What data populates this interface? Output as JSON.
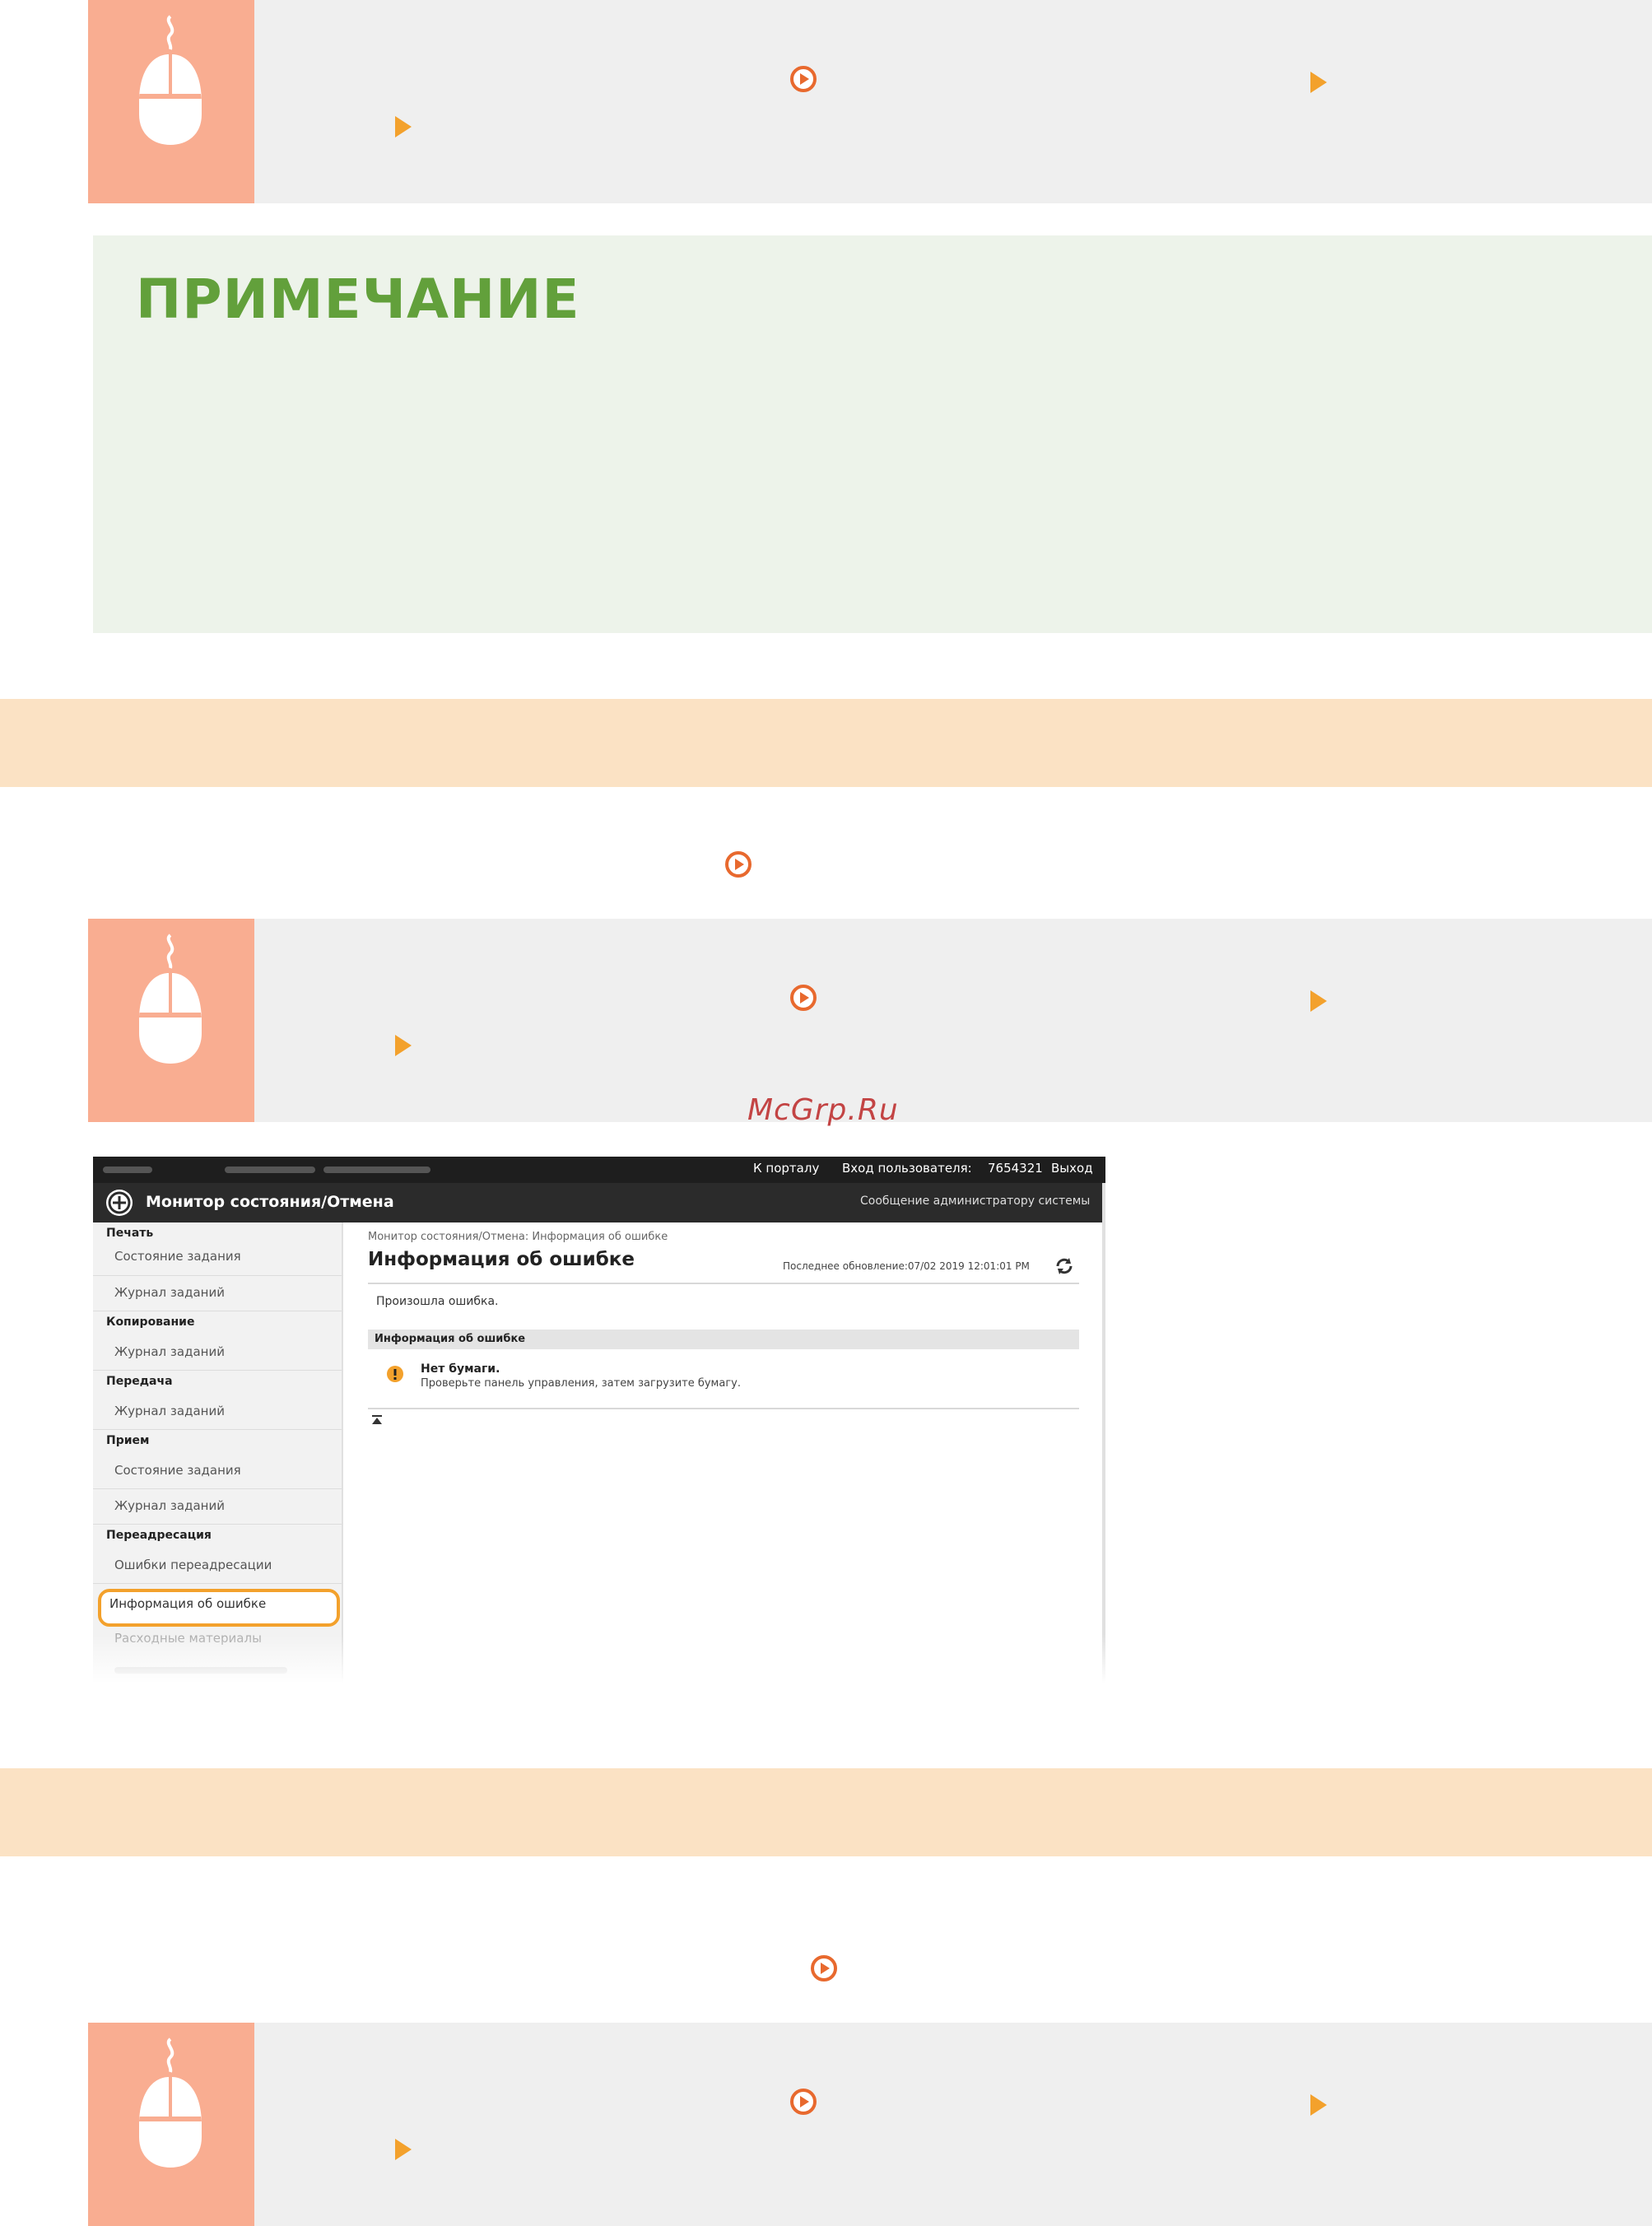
{
  "note": {
    "title": "ПРИМЕЧАНИЕ"
  },
  "watermark": "McGrp.Ru",
  "icons": {
    "mouse": "mouse-icon",
    "circle_arrow": "circle-arrow-icon",
    "triangle": "triangle-arrow-icon"
  },
  "colors": {
    "mouse_tile": "#f9ad91",
    "note_title": "#62a03b",
    "band": "#fbe2c4",
    "accent": "#e8692e"
  },
  "screenshot": {
    "top_links": [
      "К порталу",
      "Вход пользователя:",
      "7654321",
      "Выход"
    ],
    "header_title": "Монитор состояния/Отмена",
    "header_link": "Сообщение администратору системы",
    "sidebar": [
      {
        "category": "Печать",
        "items": [
          "Состояние задания",
          "Журнал заданий"
        ]
      },
      {
        "category": "Копирование",
        "items": [
          "Журнал заданий"
        ]
      },
      {
        "category": "Передача",
        "items": [
          "Журнал заданий"
        ]
      },
      {
        "category": "Прием",
        "items": [
          "Состояние задания",
          "Журнал заданий"
        ]
      },
      {
        "category": "Переадресация",
        "items": [
          "Ошибки переадресации",
          "Информация об ошибке",
          "Расходные материалы"
        ]
      }
    ],
    "breadcrumb": "Монитор состояния/Отмена: Информация об ошибке",
    "page_title": "Информация об ошибке",
    "last_update": "Последнее обновление:07/02 2019 12:01:01 PM",
    "message": "Произошла ошибка.",
    "section_header": "Информация об ошибке",
    "error_title": "Нет бумаги.",
    "error_detail": "Проверьте панель управления, затем загрузите бумагу."
  }
}
